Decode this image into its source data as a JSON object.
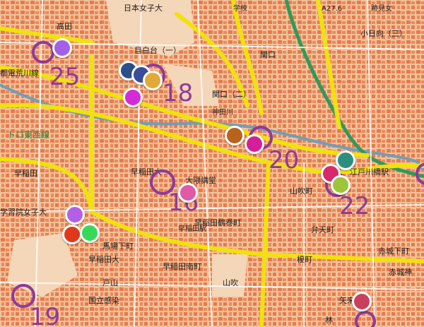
{
  "map": {
    "colors": {
      "land": "#f0c39a",
      "blocks": "#e8794e",
      "road": "#f1e10c",
      "rail": "#2f9a5a",
      "river": "#6f9fb8",
      "cluster": "#8e3a9a"
    },
    "labels": {
      "nihon_joshi": "日本女子大",
      "gakko": "学校",
      "takada": "高田",
      "mejirodai": "目白台（一）",
      "sekiguchi": "関口",
      "sekiguchi2": "関口（二）",
      "kanda_river": "神田川",
      "kohinata": "小日向（三）",
      "waseda_top": "早稲田",
      "toden": "都電荒川線",
      "tozai": "トロ東西線",
      "waseda_univ": "早稲田大",
      "omiya": "大隈講堂",
      "tsurumaki": "早稲田鶴巻町",
      "yamabuki": "山吹町",
      "edogawa": "江戸川橋駅",
      "gakushuin": "学習院女子大",
      "babashita": "馬場下町",
      "waseda_mid": "早稲田大",
      "minami": "早稲田南町",
      "waseda_stn": "早稲田駅",
      "akagi": "赤城下町",
      "benten": "弁天町",
      "enokicho": "榎町",
      "toyama": "戸山",
      "kokuritsu": "国立感染",
      "yamabuki2": "山吹",
      "akagi_jinja": "赤城神",
      "yaraicho": "矢来町",
      "hayashi": "林",
      "koishikawa": "跡見女",
      "elev": "A27.6"
    },
    "clusters": [
      {
        "label": "25"
      },
      {
        "label": "18"
      },
      {
        "label": "20"
      },
      {
        "label": "22"
      },
      {
        "label": "19"
      },
      {
        "label": "16"
      }
    ],
    "markers": [
      {
        "color": "#a45fe8"
      },
      {
        "color": "#2a4f8a"
      },
      {
        "color": "#3a4d9a"
      },
      {
        "color": "#e0a93a"
      },
      {
        "color": "#d52bd5"
      },
      {
        "color": "#b8621c"
      },
      {
        "color": "#d41f9a"
      },
      {
        "color": "#2a8f7e"
      },
      {
        "color": "#d82a6a"
      },
      {
        "color": "#9ec53a"
      },
      {
        "color": "#e05aa8"
      },
      {
        "color": "#b55ee8"
      },
      {
        "color": "#e0391a"
      },
      {
        "color": "#3ad85a"
      },
      {
        "color": "#c8405e"
      }
    ]
  }
}
